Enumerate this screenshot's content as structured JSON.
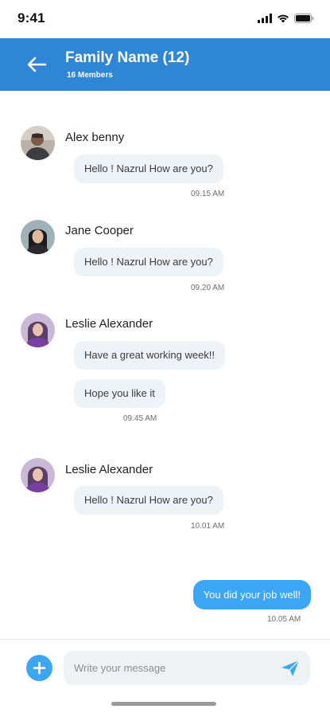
{
  "status_bar": {
    "time": "9:41"
  },
  "header": {
    "title": "Family Name (12)",
    "subtitle": "16 Members"
  },
  "messages": [
    {
      "sender": "Alex benny",
      "bubbles": [
        "Hello ! Nazrul How are you?"
      ],
      "time": "09.15 AM"
    },
    {
      "sender": "Jane Cooper",
      "bubbles": [
        "Hello ! Nazrul How are you?"
      ],
      "time": "09.20 AM"
    },
    {
      "sender": "Leslie Alexander",
      "bubbles": [
        "Have a great working week!!",
        "Hope you like it"
      ],
      "time": "09.45 AM"
    },
    {
      "sender": "Leslie Alexander",
      "bubbles": [
        "Hello ! Nazrul How are you?"
      ],
      "time": "10.01 AM"
    }
  ],
  "outgoing": {
    "text": "You did your job well!",
    "time": "10.05 AM"
  },
  "composer": {
    "placeholder": "Write your message"
  },
  "colors": {
    "accent": "#2f86d6",
    "bubble_out": "#3aa6f5",
    "bubble_in": "#eef3f8"
  },
  "icons": [
    "back-arrow-icon",
    "add-icon",
    "send-icon",
    "signal-icon",
    "wifi-icon",
    "battery-icon"
  ]
}
